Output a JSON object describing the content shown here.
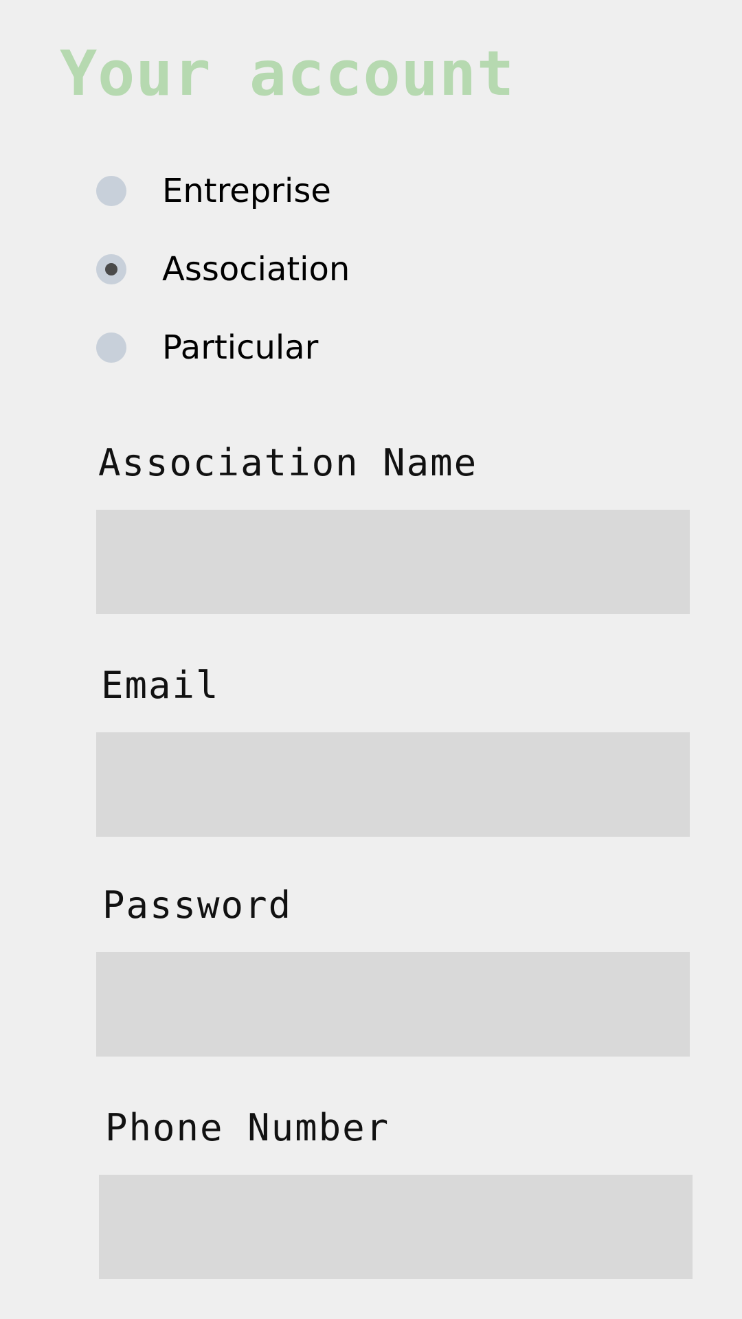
{
  "header": {
    "title": "Your account"
  },
  "account_type": {
    "options": [
      {
        "label": "Entreprise",
        "selected": false
      },
      {
        "label": "Association",
        "selected": true
      },
      {
        "label": "Particular",
        "selected": false
      }
    ]
  },
  "form": {
    "fields": [
      {
        "label": "Association Name",
        "value": ""
      },
      {
        "label": "Email",
        "value": ""
      },
      {
        "label": "Password",
        "value": ""
      },
      {
        "label": "Phone Number",
        "value": ""
      }
    ]
  },
  "colors": {
    "background": "#efefef",
    "title": "#b6d9b0",
    "radio": "#c8d0da",
    "radio_selected_dot": "#4a4a4a",
    "input_background": "#d9d9d9"
  }
}
